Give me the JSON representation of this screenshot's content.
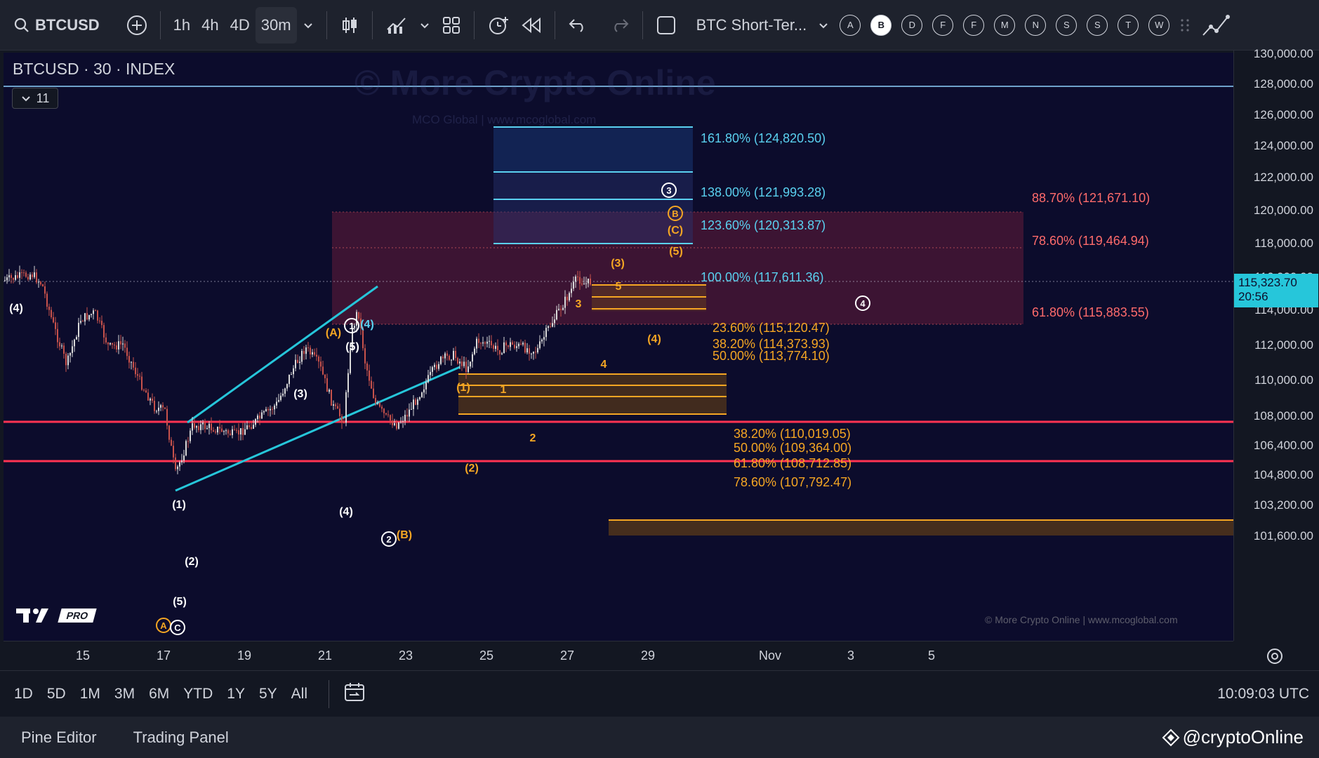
{
  "toolbar": {
    "symbol": "BTCUSD",
    "intervals": [
      "1h",
      "4h",
      "4D",
      "30m"
    ],
    "active_interval": "30m",
    "layout_name": "BTC Short-Ter...",
    "letter_buttons": [
      "A",
      "B",
      "D",
      "F",
      "F",
      "M",
      "N",
      "S",
      "S",
      "T",
      "W"
    ],
    "selected_letter": "B"
  },
  "chart": {
    "title": "BTCUSD · 30 · INDEX",
    "indicator_count": "11",
    "watermark": "© More Crypto Online",
    "subwatermark": "MCO Global   |   www.mcoglobal.com",
    "credit": "© More Crypto Online   |   www.mcoglobal.com",
    "tv_logo": "PRO"
  },
  "price_axis": {
    "labels": [
      "130,000.00",
      "128,000.00",
      "126,000.00",
      "124,000.00",
      "122,000.00",
      "120,000.00",
      "118,000.00",
      "116,000.00",
      "114,000.00",
      "112,000.00",
      "110,000.00",
      "108,000.00",
      "106,400.00",
      "104,800.00",
      "103,200.00",
      "101,600.00"
    ],
    "current_price": "115,323.70",
    "countdown": "20:56"
  },
  "time_axis": {
    "labels": [
      "15",
      "17",
      "19",
      "21",
      "23",
      "25",
      "27",
      "29",
      "Nov",
      "3",
      "5"
    ]
  },
  "fib_blue": [
    {
      "label": "161.80% (124,820.50)"
    },
    {
      "label": "138.00% (121,993.28)"
    },
    {
      "label": "123.60% (120,313.87)"
    },
    {
      "label": "100.00% (117,611.36)"
    }
  ],
  "fib_red": [
    {
      "label": "88.70% (121,671.10)"
    },
    {
      "label": "78.60% (119,464.94)"
    },
    {
      "label": "61.80% (115,883.55)"
    }
  ],
  "fib_orange_upper": [
    {
      "label": "23.60% (115,120.47)"
    },
    {
      "label": "38.20% (114,373.93)"
    },
    {
      "label": "50.00% (113,774.10)"
    }
  ],
  "fib_orange_lower": [
    {
      "label": "38.20% (110,019.05)"
    },
    {
      "label": "50.00% (109,364.00)"
    },
    {
      "label": "61.80% (108,712.85)"
    },
    {
      "label": "78.60% (107,792.47)"
    }
  ],
  "wave_labels": {
    "w4_left": "(4)",
    "wA": "(A)",
    "w5_top": "(5)",
    "w4_blue": "(4)",
    "w3": "(3)",
    "w1": "(1)",
    "w2": "(2)",
    "w5_low": "(5)",
    "w4_mid": "(4)",
    "wB_low": "(B)",
    "o1": "(1)",
    "o_1": "1",
    "o_2": "2",
    "o_3": "3",
    "o_3p": "(3)",
    "o_5": "5",
    "o_4p": "(4)",
    "o_4": "4",
    "o_2p": "(2)",
    "o_5p": "(5)",
    "o_Cp": "(C)"
  },
  "wave_circles": {
    "c1": "1",
    "c2": "2",
    "c3": "3",
    "c4": "4",
    "cB": "B",
    "cA": "A",
    "cC": "C"
  },
  "range_bar": {
    "ranges": [
      "1D",
      "5D",
      "1M",
      "3M",
      "6M",
      "YTD",
      "1Y",
      "5Y",
      "All"
    ],
    "clock": "10:09:03 UTC"
  },
  "bottom_bar": {
    "tabs": [
      "Pine Editor",
      "Trading Panel"
    ],
    "brand": "@cryptoOnline"
  },
  "colors": {
    "blue_fib": "#5ad1f0",
    "red_fib": "#ff6b6b",
    "orange_fib": "#f5a623",
    "red_line": "#ff3352",
    "trend_line": "#26c6da",
    "up_candle": "#d9d9d9",
    "down_candle": "#c8524b"
  }
}
